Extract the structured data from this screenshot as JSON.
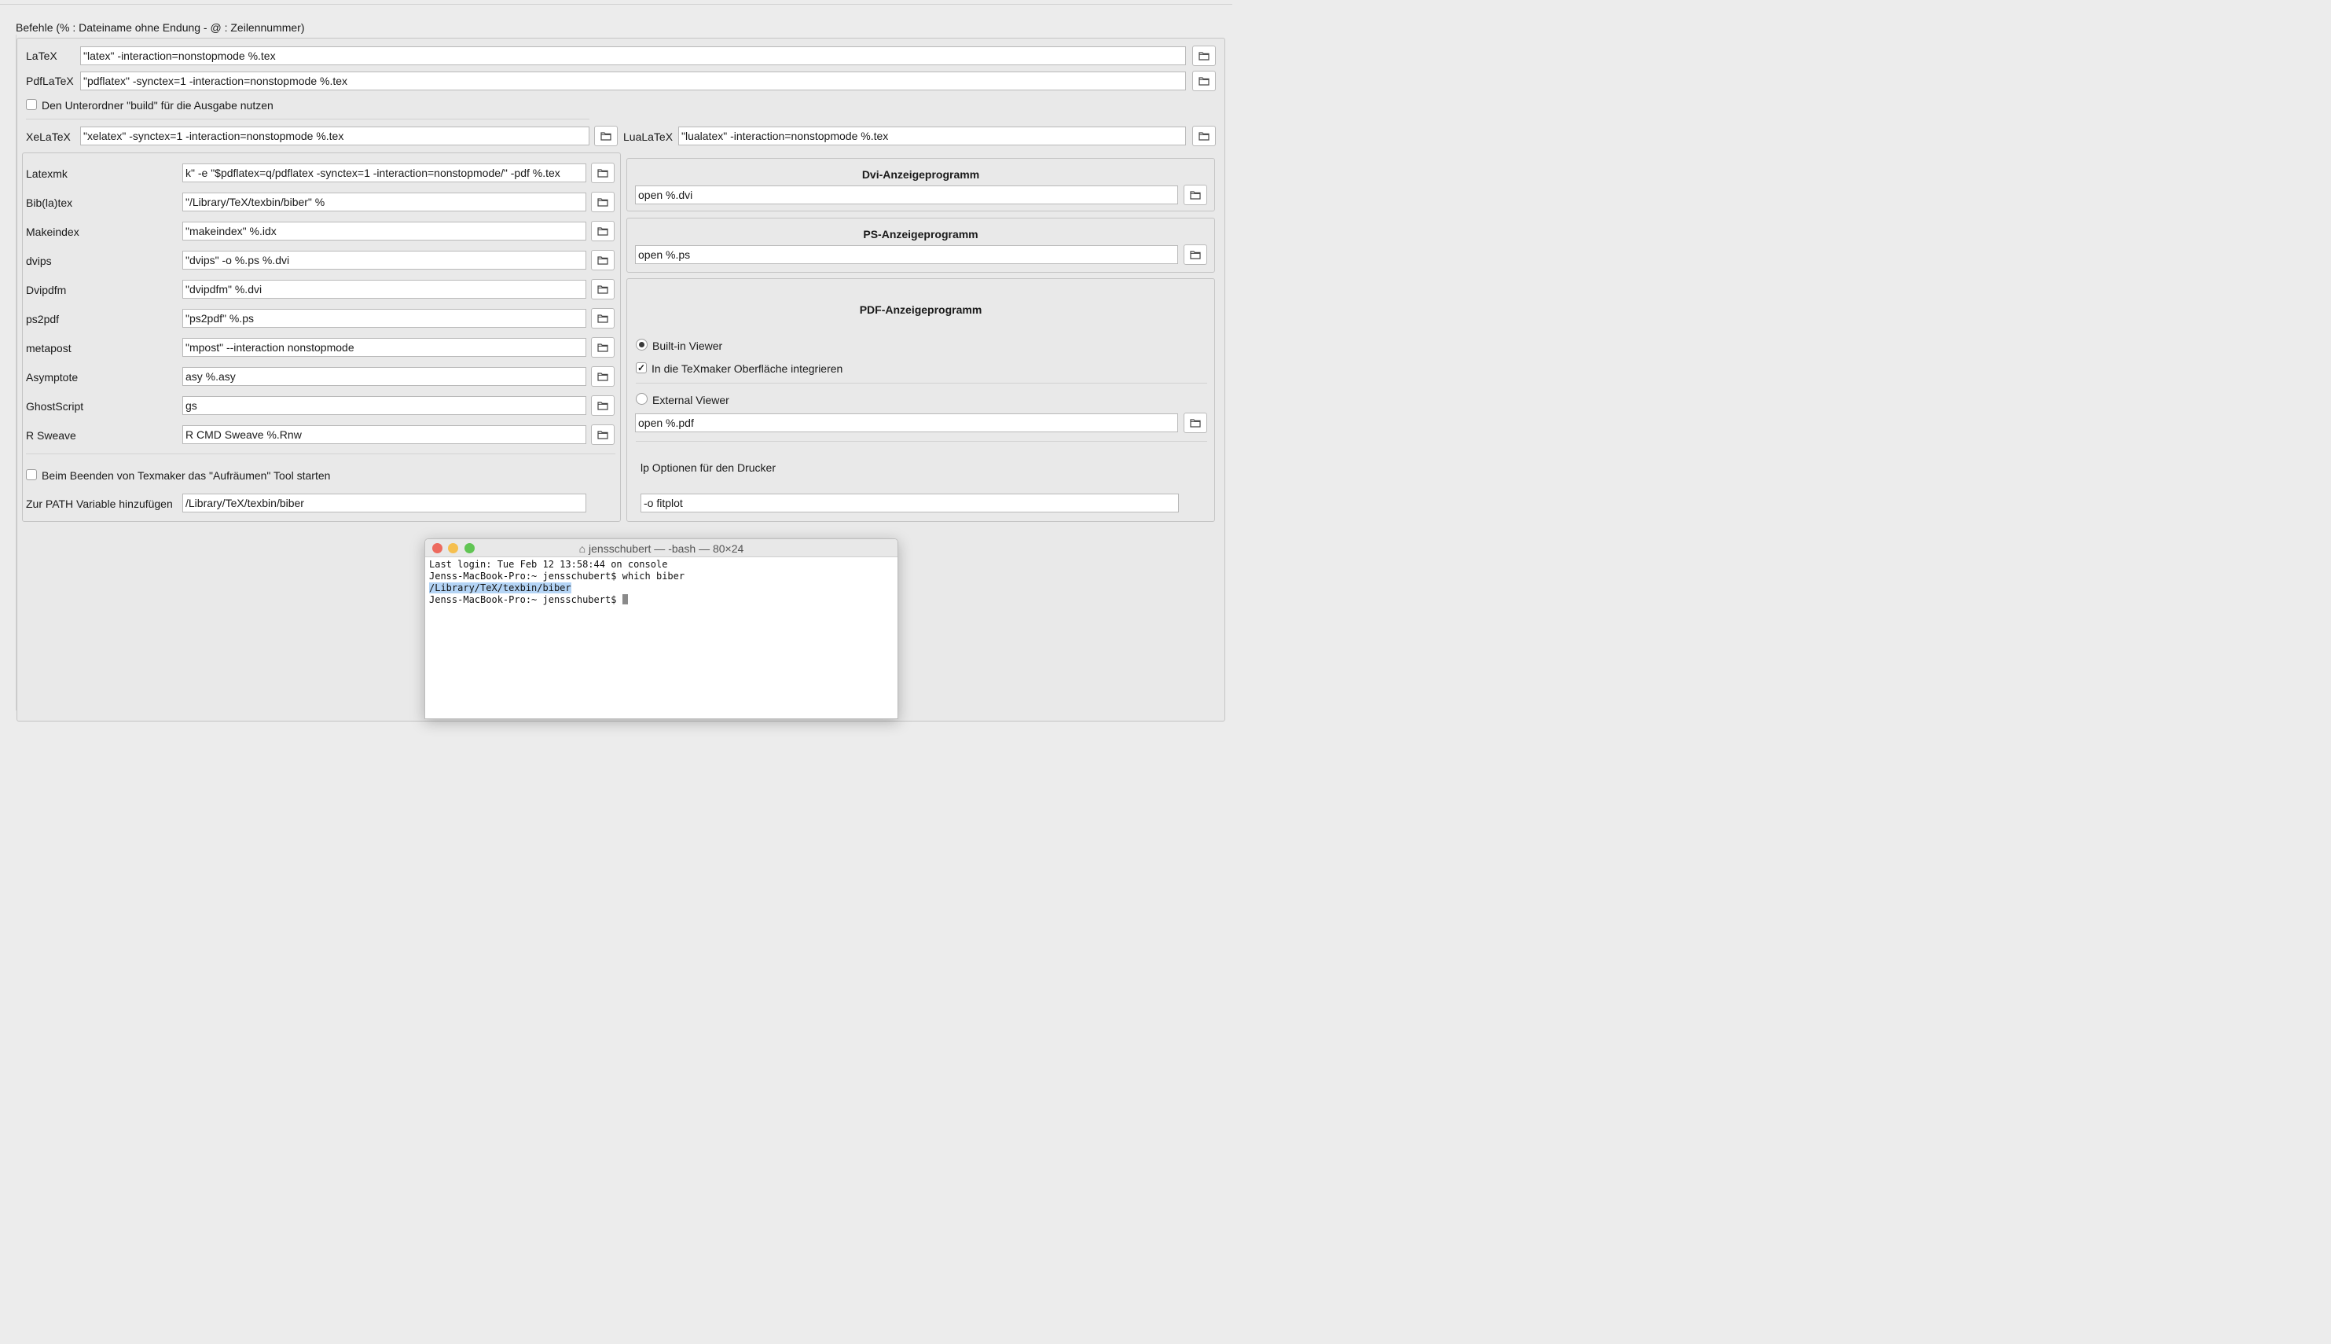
{
  "section_title": "Befehle (% : Dateiname ohne Endung - @ : Zeilennummer)",
  "top_commands": [
    {
      "label": "LaTeX",
      "value": "\"latex\" -interaction=nonstopmode %.tex"
    },
    {
      "label": "PdfLaTeX",
      "value": "\"pdflatex\" -synctex=1 -interaction=nonstopmode %.tex"
    }
  ],
  "build_subfolder_label": "Den Unterordner \"build\" für die Ausgabe nutzen",
  "xelatex": {
    "label": "XeLaTeX",
    "value": "\"xelatex\" -synctex=1 -interaction=nonstopmode %.tex"
  },
  "lualatex": {
    "label": "LuaLaTeX",
    "value": "\"lualatex\" -interaction=nonstopmode %.tex"
  },
  "tools": [
    {
      "label": "Latexmk",
      "value": "k\" -e \"$pdflatex=q/pdflatex -synctex=1 -interaction=nonstopmode/\" -pdf %.tex"
    },
    {
      "label": "Bib(la)tex",
      "value": "\"/Library/TeX/texbin/biber\" %"
    },
    {
      "label": "Makeindex",
      "value": "\"makeindex\" %.idx"
    },
    {
      "label": "dvips",
      "value": "\"dvips\" -o %.ps %.dvi"
    },
    {
      "label": "Dvipdfm",
      "value": "\"dvipdfm\" %.dvi"
    },
    {
      "label": "ps2pdf",
      "value": "\"ps2pdf\" %.ps"
    },
    {
      "label": "metapost",
      "value": "\"mpost\" --interaction nonstopmode"
    },
    {
      "label": "Asymptote",
      "value": "asy %.asy"
    },
    {
      "label": "GhostScript",
      "value": "gs"
    },
    {
      "label": "R Sweave",
      "value": "R CMD Sweave %.Rnw"
    }
  ],
  "cleanup_label": "Beim Beenden von Texmaker das \"Aufräumen\" Tool starten",
  "path_label": "Zur PATH Variable hinzufügen",
  "path_value": "/Library/TeX/texbin/biber",
  "dvi_viewer": {
    "title": "Dvi-Anzeigeprogramm",
    "value": "open %.dvi"
  },
  "ps_viewer": {
    "title": "PS-Anzeigeprogramm",
    "value": "open %.ps"
  },
  "pdf_viewer": {
    "title": "PDF-Anzeigeprogramm",
    "builtin_label": "Built-in Viewer",
    "integrate_label": "In die TeXmaker Oberfläche integrieren",
    "external_label": "External Viewer",
    "external_value": "open %.pdf",
    "lp_label": "lp Optionen für den Drucker",
    "lp_value": "-o fitplot"
  },
  "terminal": {
    "title": "jensschubert — -bash — 80×24",
    "line1": "Last login: Tue Feb 12 13:58:44 on console",
    "line2": "Jenss-MacBook-Pro:~ jensschubert$ which biber",
    "line3": "/Library/TeX/texbin/biber",
    "line4": "Jenss-MacBook-Pro:~ jensschubert$ "
  },
  "colors": {
    "close": "#ed6a5e",
    "minimize": "#f5bf4f",
    "zoom": "#61c554",
    "selection": "#b4d4f5"
  }
}
